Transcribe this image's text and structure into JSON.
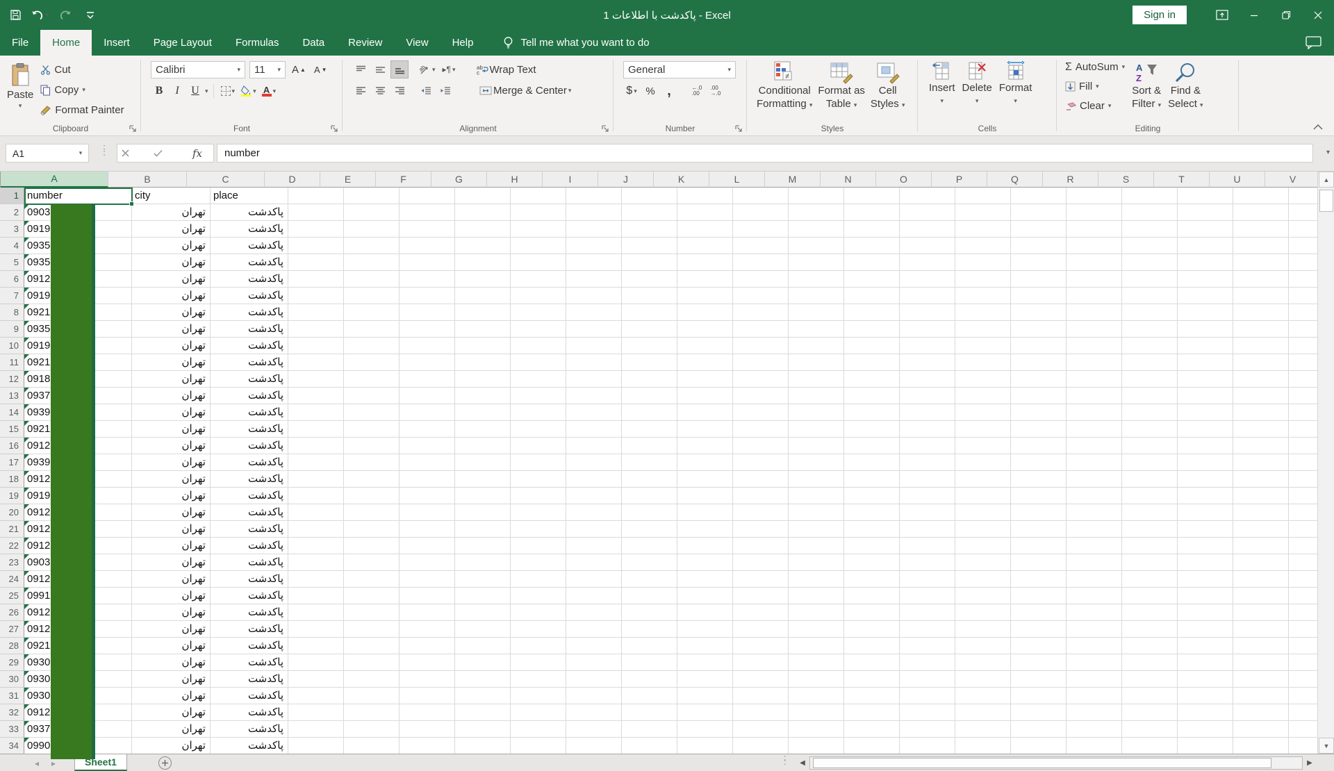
{
  "titlebar": {
    "title": "پاکدشت با اطلاعات 1  -  Excel",
    "sign_in": "Sign in"
  },
  "tabs": {
    "items": [
      "File",
      "Home",
      "Insert",
      "Page Layout",
      "Formulas",
      "Data",
      "Review",
      "View",
      "Help"
    ],
    "active": "Home",
    "tell_me": "Tell me what you want to do"
  },
  "ribbon": {
    "clipboard": {
      "label": "Clipboard",
      "paste": "Paste",
      "cut": "Cut",
      "copy": "Copy",
      "format_painter": "Format Painter"
    },
    "font": {
      "label": "Font",
      "font_name": "Calibri",
      "font_size": "11",
      "bold": "B",
      "italic": "I",
      "underline": "U"
    },
    "alignment": {
      "label": "Alignment",
      "wrap_text": "Wrap Text",
      "merge_center": "Merge & Center"
    },
    "number": {
      "label": "Number",
      "format": "General",
      "currency": "$",
      "percent": "%",
      "comma": ","
    },
    "styles": {
      "label": "Styles",
      "conditional": [
        "Conditional",
        "Formatting"
      ],
      "format_table": [
        "Format as",
        "Table"
      ],
      "cell_styles": [
        "Cell",
        "Styles"
      ]
    },
    "cells": {
      "label": "Cells",
      "insert": "Insert",
      "delete": "Delete",
      "format": "Format"
    },
    "editing": {
      "label": "Editing",
      "sigma": "Σ",
      "autosum": "AutoSum",
      "fill": "Fill",
      "clear": "Clear",
      "sort_filter": [
        "Sort &",
        "Filter"
      ],
      "find_select": [
        "Find &",
        "Select"
      ]
    }
  },
  "formula_bar": {
    "name_box": "A1",
    "fx": "fx",
    "value": "number"
  },
  "grid": {
    "columns": [
      "A",
      "B",
      "C",
      "D",
      "E",
      "F",
      "G",
      "H",
      "I",
      "J",
      "K",
      "L",
      "M",
      "N",
      "O",
      "P",
      "Q",
      "R",
      "S",
      "T",
      "U",
      "V"
    ],
    "header_row": {
      "n": 1,
      "a": "number",
      "b": "city",
      "c": "place"
    },
    "rows": [
      {
        "n": 2,
        "a": "0903",
        "b": "تهران",
        "c": "پاکدشت"
      },
      {
        "n": 3,
        "a": "0919",
        "b": "تهران",
        "c": "پاکدشت"
      },
      {
        "n": 4,
        "a": "0935",
        "b": "تهران",
        "c": "پاکدشت"
      },
      {
        "n": 5,
        "a": "0935",
        "b": "تهران",
        "c": "پاکدشت"
      },
      {
        "n": 6,
        "a": "0912",
        "b": "تهران",
        "c": "پاکدشت"
      },
      {
        "n": 7,
        "a": "0919",
        "b": "تهران",
        "c": "پاکدشت"
      },
      {
        "n": 8,
        "a": "0921",
        "b": "تهران",
        "c": "پاکدشت"
      },
      {
        "n": 9,
        "a": "0935",
        "b": "تهران",
        "c": "پاکدشت"
      },
      {
        "n": 10,
        "a": "0919",
        "b": "تهران",
        "c": "پاکدشت"
      },
      {
        "n": 11,
        "a": "0921",
        "b": "تهران",
        "c": "پاکدشت"
      },
      {
        "n": 12,
        "a": "0918",
        "b": "تهران",
        "c": "پاکدشت"
      },
      {
        "n": 13,
        "a": "0937",
        "b": "تهران",
        "c": "پاکدشت"
      },
      {
        "n": 14,
        "a": "0939",
        "b": "تهران",
        "c": "پاکدشت"
      },
      {
        "n": 15,
        "a": "0921",
        "b": "تهران",
        "c": "پاکدشت"
      },
      {
        "n": 16,
        "a": "0912",
        "b": "تهران",
        "c": "پاکدشت"
      },
      {
        "n": 17,
        "a": "0939",
        "b": "تهران",
        "c": "پاکدشت"
      },
      {
        "n": 18,
        "a": "0912",
        "b": "تهران",
        "c": "پاکدشت"
      },
      {
        "n": 19,
        "a": "0919",
        "b": "تهران",
        "c": "پاکدشت"
      },
      {
        "n": 20,
        "a": "0912",
        "b": "تهران",
        "c": "پاکدشت"
      },
      {
        "n": 21,
        "a": "0912",
        "b": "تهران",
        "c": "پاکدشت"
      },
      {
        "n": 22,
        "a": "0912",
        "b": "تهران",
        "c": "پاکدشت"
      },
      {
        "n": 23,
        "a": "0903",
        "b": "تهران",
        "c": "پاکدشت"
      },
      {
        "n": 24,
        "a": "0912",
        "b": "تهران",
        "c": "پاکدشت"
      },
      {
        "n": 25,
        "a": "0991",
        "b": "تهران",
        "c": "پاکدشت"
      },
      {
        "n": 26,
        "a": "0912",
        "b": "تهران",
        "c": "پاکدشت"
      },
      {
        "n": 27,
        "a": "0912",
        "b": "تهران",
        "c": "پاکدشت"
      },
      {
        "n": 28,
        "a": "0921",
        "b": "تهران",
        "c": "پاکدشت"
      },
      {
        "n": 29,
        "a": "0930",
        "b": "تهران",
        "c": "پاکدشت"
      },
      {
        "n": 30,
        "a": "0930",
        "b": "تهران",
        "c": "پاکدشت"
      },
      {
        "n": 31,
        "a": "0930",
        "b": "تهران",
        "c": "پاکدشت"
      },
      {
        "n": 32,
        "a": "0912",
        "b": "تهران",
        "c": "پاکدشت"
      },
      {
        "n": 33,
        "a": "0937",
        "b": "تهران",
        "c": "پاکدشت"
      },
      {
        "n": 34,
        "a": "0990",
        "b": "تهران",
        "c": "پاکدشت"
      }
    ]
  },
  "sheet_bar": {
    "tab": "Sheet1"
  },
  "colors": {
    "brand_green": "#217346",
    "overlay_fill": "#38791f",
    "overlay_edge": "#1e6b46",
    "selected_header_bg": "#c8e0ce",
    "fill_yellow": "#ffff00",
    "font_red": "#e03b32"
  }
}
